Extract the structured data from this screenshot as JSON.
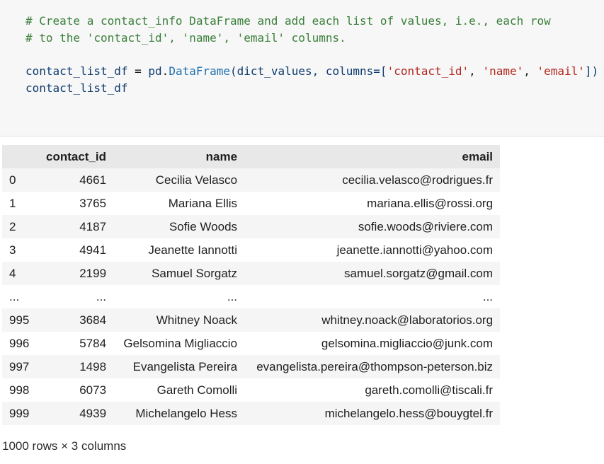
{
  "code": {
    "comment_line_1": "# Create a contact_info DataFrame and add each list of values, i.e., each row",
    "comment_line_2": "# to the 'contact_id', 'name', 'email' columns.",
    "line3": {
      "var": "contact_list_df",
      "op": " = ",
      "module": "pd",
      "dot": ".",
      "func": "DataFrame",
      "open": "(dict_values, columns=[",
      "s1": "'contact_id'",
      "sep1": ", ",
      "s2": "'name'",
      "sep2": ", ",
      "s3": "'email'",
      "close": "])"
    },
    "line4": "contact_list_df"
  },
  "table": {
    "columns": [
      "contact_id",
      "name",
      "email"
    ],
    "rows": [
      {
        "index": "0",
        "contact_id": "4661",
        "name": "Cecilia Velasco",
        "email": "cecilia.velasco@rodrigues.fr"
      },
      {
        "index": "1",
        "contact_id": "3765",
        "name": "Mariana Ellis",
        "email": "mariana.ellis@rossi.org"
      },
      {
        "index": "2",
        "contact_id": "4187",
        "name": "Sofie Woods",
        "email": "sofie.woods@riviere.com"
      },
      {
        "index": "3",
        "contact_id": "4941",
        "name": "Jeanette Iannotti",
        "email": "jeanette.iannotti@yahoo.com"
      },
      {
        "index": "4",
        "contact_id": "2199",
        "name": "Samuel Sorgatz",
        "email": "samuel.sorgatz@gmail.com"
      },
      {
        "index": "...",
        "contact_id": "...",
        "name": "...",
        "email": "..."
      },
      {
        "index": "995",
        "contact_id": "3684",
        "name": "Whitney Noack",
        "email": "whitney.noack@laboratorios.org"
      },
      {
        "index": "996",
        "contact_id": "5784",
        "name": "Gelsomina Migliaccio",
        "email": "gelsomina.migliaccio@junk.com"
      },
      {
        "index": "997",
        "contact_id": "1498",
        "name": "Evangelista Pereira",
        "email": "evangelista.pereira@thompson-peterson.biz"
      },
      {
        "index": "998",
        "contact_id": "6073",
        "name": "Gareth Comolli",
        "email": "gareth.comolli@tiscali.fr"
      },
      {
        "index": "999",
        "contact_id": "4939",
        "name": "Michelangelo Hess",
        "email": "michelangelo.hess@bouygtel.fr"
      }
    ],
    "shape_text": "1000 rows × 3 columns"
  }
}
